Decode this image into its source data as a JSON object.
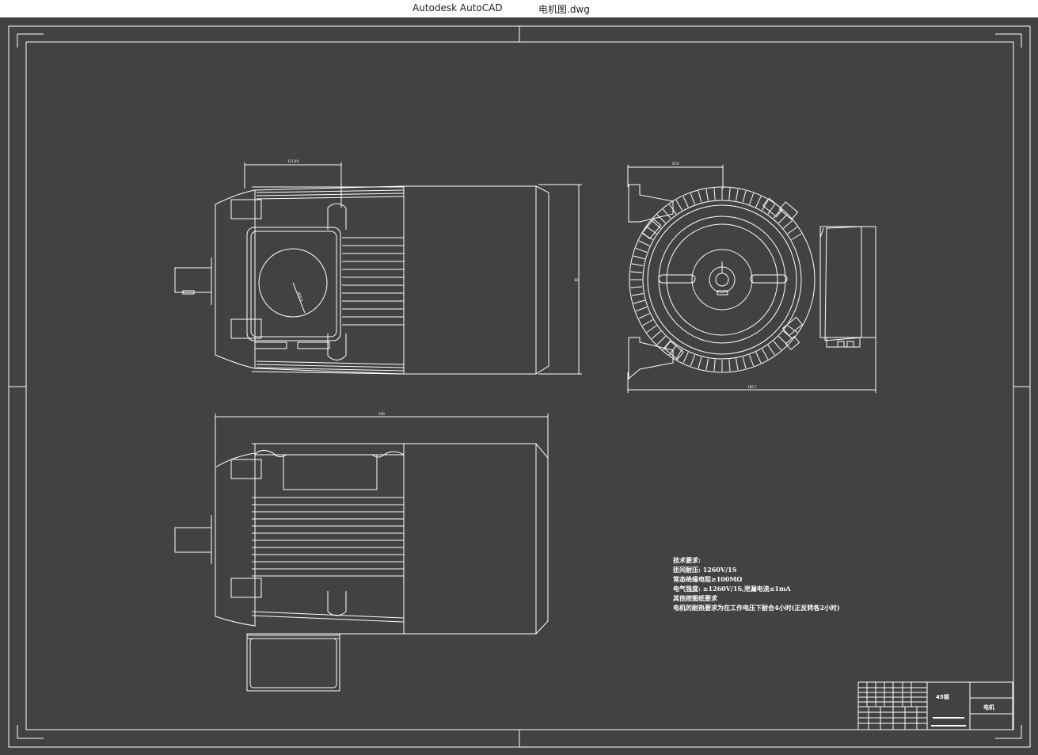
{
  "window": {
    "app_title": "Autodesk AutoCAD",
    "file_name": "电机图.dwg"
  },
  "colors": {
    "background": "#424242",
    "linework": "#ffffff"
  },
  "dimensions": {
    "front_width": "111.40",
    "front_height": "82",
    "side_width_top": "33.0",
    "side_width_bottom": "180.7",
    "bottom_overall": "200",
    "front_circle": "Ø38.9"
  },
  "technical_requirements": {
    "title": "技术要求:",
    "lines": [
      "匝间耐压: 1260V/1S",
      "常态绝缘电阻≥100MΩ",
      "电气强度: ≥1260V/1S,泄漏电流≤1mA",
      "其他按图纸要求",
      "电机的耐热要求为在工作电压下耐合4小时(正反转各2小时)"
    ]
  },
  "title_block": {
    "material": "45钢",
    "part_name": "电机"
  }
}
